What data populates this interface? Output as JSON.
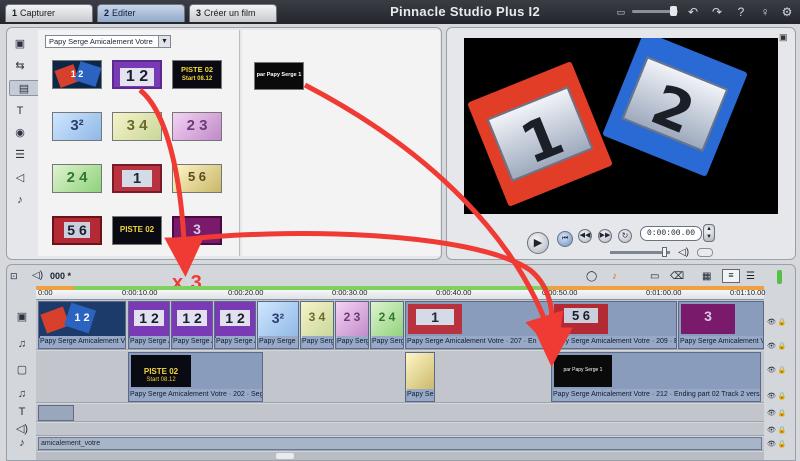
{
  "tabs": [
    {
      "num": "1",
      "label": "Capturer"
    },
    {
      "num": "2",
      "label": "Editer"
    },
    {
      "num": "3",
      "label": "Créer un film"
    }
  ],
  "app_title": "Pinnacle Studio Plus I2",
  "album": {
    "dropdown_value": "Papy Serge Amicalement Votre",
    "thumbs": [
      {
        "text": "1 2"
      },
      {
        "text": "1 2"
      },
      {
        "text": "PISTE 02",
        "sub": "Start 08.12"
      },
      {
        "text": "3²"
      },
      {
        "text": "3 4"
      },
      {
        "text": "2 3"
      },
      {
        "text": "2 4"
      },
      {
        "text": "1"
      },
      {
        "text": "5 6"
      },
      {
        "text": "5 6"
      },
      {
        "text": "PISTE 02"
      },
      {
        "text": "3"
      }
    ],
    "right_thumb_text": "par Papy Serge 1"
  },
  "preview": {
    "digit1": "1",
    "digit2": "2",
    "timecode": "0:00:00.00"
  },
  "timeline": {
    "project_label": "000 *",
    "annotation": "x 3",
    "ruler_labels": [
      "0:00",
      "0:00:10.00",
      "0:00:20.00",
      "0:00:30.00",
      "0:00:40.00",
      "0:00:50.00",
      "0:01:00.00",
      "0:01:10.00"
    ],
    "video_captions": [
      "Papy Serge Amicalement Votre",
      "Papy Serge A",
      "Papy Serge A",
      "Papy Serge A",
      "Papy Serge",
      "Papy Serge",
      "Papy Serge A",
      "Papy Serge Amicalement Votre · 207 · En",
      "Papy Serge Amicalement Votre · 209 · En",
      "Papy Serge Amicalement V"
    ],
    "title_captions": [
      "Papy Serge Amicalement Votre · 202 · Segu",
      "Papy Ser",
      "Papy Serge Amicalement Votre · 212 · Ending part 02 Track 2 versio"
    ],
    "title_clip_text": "PISTE 02",
    "title_clip_sub": "Start 08.12",
    "title_clip2_text": "par Papy Serge 1",
    "clip_numbers": [
      "1 2",
      "1 2",
      "1 2",
      "1 2",
      "3²",
      "3 4",
      "2 3",
      "2 4",
      "1",
      "5 6",
      "3"
    ],
    "music_label": "amicalement_votre"
  },
  "colors": {
    "accent_red": "#ef3b33",
    "timeline_green": "#7ed15a",
    "timeline_orange": "#f0a040"
  }
}
